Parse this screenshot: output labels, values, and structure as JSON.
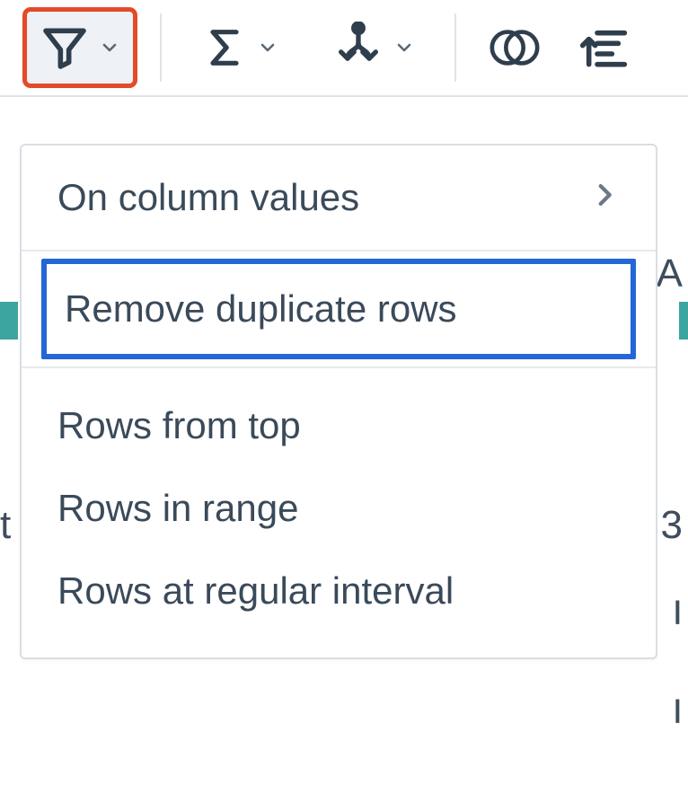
{
  "toolbar": {
    "filter": {
      "name": "filter"
    },
    "sum": {
      "name": "aggregate"
    },
    "split": {
      "name": "split"
    },
    "join": {
      "name": "join"
    },
    "sort": {
      "name": "sort"
    }
  },
  "menu": {
    "on_column_values": "On column values",
    "remove_duplicate_rows": "Remove duplicate rows",
    "rows_from_top": "Rows from top",
    "rows_in_range": "Rows in range",
    "rows_at_regular_interval": "Rows at regular interval"
  },
  "bg": {
    "a": "A",
    "b": "3",
    "c": "ו",
    "t": "t"
  }
}
